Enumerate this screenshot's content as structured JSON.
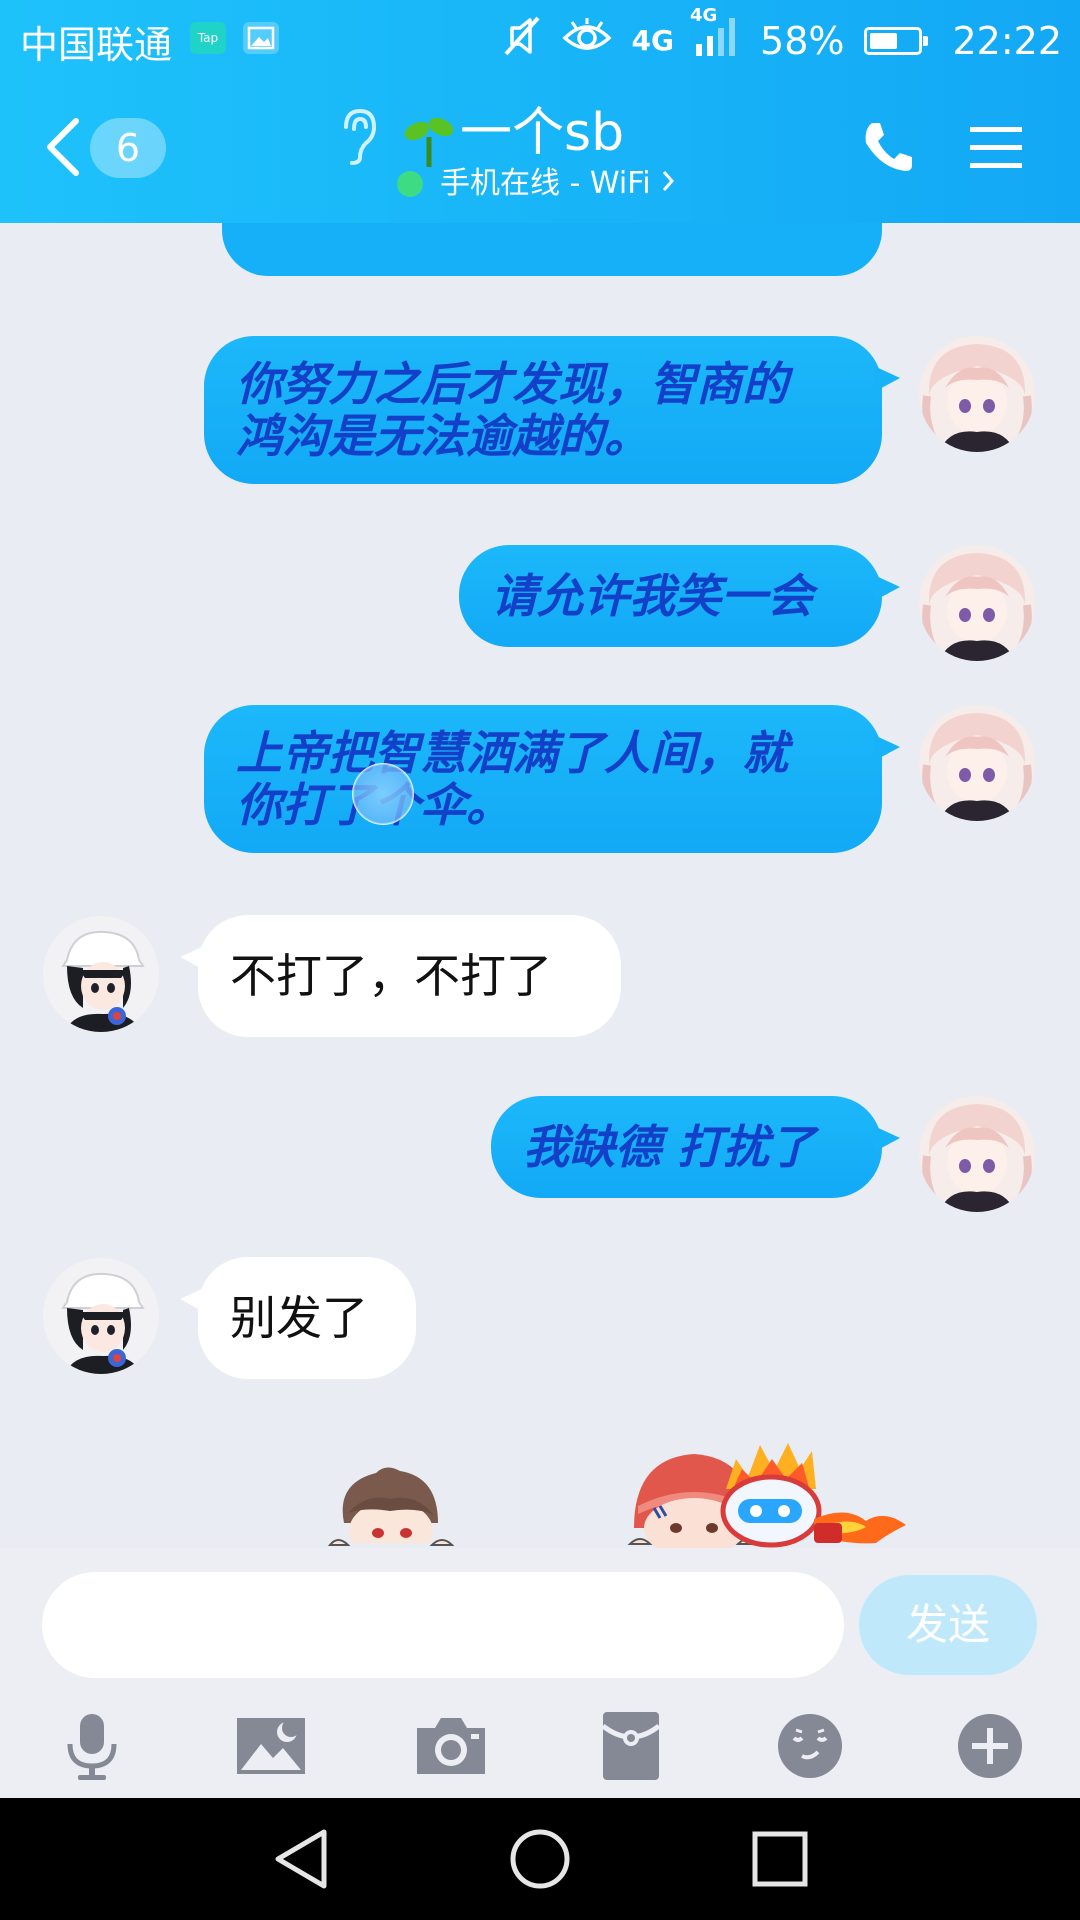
{
  "status_bar": {
    "carrier": "中国联通",
    "tap_icon_text": "Tap",
    "network_1": "4G",
    "network_2": "4G",
    "battery_percent": "58%",
    "battery_level": 0.58,
    "time": "22:22",
    "icons": [
      "tap-app-icon",
      "gallery-icon",
      "mute-icon",
      "eye-icon",
      "signal-icon",
      "battery-icon"
    ]
  },
  "header": {
    "unread_count": "6",
    "contact_name": "一个sb",
    "online_status": "手机在线 - WiFi",
    "icons": [
      "back-icon",
      "ear-icon",
      "sprout-icon",
      "phone-icon",
      "menu-icon"
    ]
  },
  "messages": [
    {
      "side": "mine",
      "text": "你努力之后才发现，智商的鸿沟是无法逾越的。",
      "lines": [
        "你努力之后才发现，智商的",
        "鸿沟是无法逾越的。"
      ]
    },
    {
      "side": "mine",
      "text": "请允许我笑一会"
    },
    {
      "side": "mine",
      "text": "上帝把智慧洒满了人间，就你打了个伞。",
      "lines": [
        "上帝把智慧洒满了人间，就",
        "你打了个伞。"
      ]
    },
    {
      "side": "theirs",
      "text": "不打了，不打了"
    },
    {
      "side": "mine",
      "text": "我缺德 打扰了"
    },
    {
      "side": "theirs",
      "text": "别发了"
    }
  ],
  "input": {
    "value": "",
    "send_label": "发送"
  },
  "toolbar": {
    "icons": [
      "microphone-icon",
      "image-icon",
      "camera-icon",
      "red-packet-icon",
      "emoji-icon",
      "plus-icon"
    ]
  },
  "nav": {
    "icons": [
      "nav-back-icon",
      "nav-home-icon",
      "nav-recents-icon"
    ]
  },
  "colors": {
    "header_blue": "#13a8f5",
    "my_bubble": "#17b2f8",
    "my_text": "#1340c9",
    "their_bubble": "#ffffff",
    "chat_bg": "#e9ecf3",
    "send_btn": "#bfe9fb"
  }
}
